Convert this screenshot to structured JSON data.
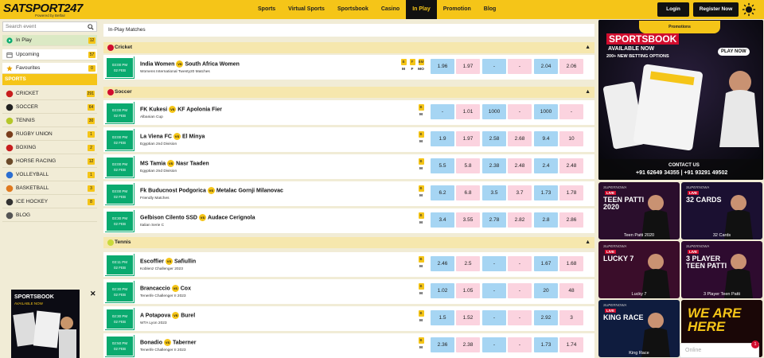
{
  "header": {
    "logo_text": "SATSPORT247",
    "logo_sub": "Powered by Betfair",
    "nav": [
      "Sports",
      "Virtual Sports",
      "Sportsbook",
      "Casino",
      "In Play",
      "Promotion",
      "Blog"
    ],
    "active_nav": "In Play",
    "login_label": "Login",
    "register_label": "Register Now"
  },
  "sidebar": {
    "search_placeholder": "Search event",
    "quick": [
      {
        "label": "In Play",
        "count": "12"
      },
      {
        "label": "Upcoming",
        "count": "57"
      },
      {
        "label": "Favourites",
        "count": "0"
      }
    ],
    "sports_label": "SPORTS",
    "sports": [
      {
        "label": "CRICKET",
        "count": "291",
        "icon": "cricket-ball-icon"
      },
      {
        "label": "SOCCER",
        "count": "64",
        "icon": "soccer-ball-icon"
      },
      {
        "label": "TENNIS",
        "count": "30",
        "icon": "tennis-ball-icon"
      },
      {
        "label": "RUGBY UNION",
        "count": "1",
        "icon": "rugby-ball-icon"
      },
      {
        "label": "BOXING",
        "count": "2",
        "icon": "boxing-glove-icon"
      },
      {
        "label": "HORSE RACING",
        "count": "12",
        "icon": "horse-icon"
      },
      {
        "label": "VOLLEYBALL",
        "count": "1",
        "icon": "volleyball-icon"
      },
      {
        "label": "BASKETBALL",
        "count": "3",
        "icon": "basketball-icon"
      },
      {
        "label": "ICE HOCKEY",
        "count": "8",
        "icon": "hockey-stick-icon"
      },
      {
        "label": "BLOG",
        "count": "",
        "icon": "blog-icon"
      }
    ],
    "ad_title": "SPORTSBOOK",
    "ad_sub": "AVAILABLE NOW"
  },
  "main": {
    "breadcrumb": "In-Play Matches",
    "sections": [
      {
        "name": "Cricket",
        "color": "#d10d2e",
        "matches": [
          {
            "time": "03:00 PM",
            "date": "02 FEB",
            "home": "India Women",
            "away": "South Africa Women",
            "league": "Womens International Twenty20 Matches",
            "markets": [
              {
                "b": "B",
                "t": "M"
              },
              {
                "b": "F",
                "t": "F"
              },
              {
                "b": "BM",
                "t": "MO"
              }
            ],
            "odds": [
              "1.96",
              "1.97",
              "-",
              "-",
              "2.04",
              "2.06"
            ]
          }
        ]
      },
      {
        "name": "Soccer",
        "color": "#d10d2e",
        "matches": [
          {
            "time": "03:00 PM",
            "date": "02 FEB",
            "home": "FK Kukesi",
            "away": "KF Apolonia Fier",
            "league": "Albanian Cup",
            "markets": [
              {
                "b": "B",
                "t": "M"
              }
            ],
            "odds": [
              "-",
              "1.01",
              "1000",
              "-",
              "1000",
              "-"
            ]
          },
          {
            "time": "03:00 PM",
            "date": "02 FEB",
            "home": "La Viena FC",
            "away": "El Minya",
            "league": "Egyptian 2nd Division",
            "markets": [
              {
                "b": "B",
                "t": "M"
              }
            ],
            "odds": [
              "1.9",
              "1.97",
              "2.58",
              "2.68",
              "9.4",
              "10"
            ]
          },
          {
            "time": "03:00 PM",
            "date": "02 FEB",
            "home": "MS Tamia",
            "away": "Nasr Taaden",
            "league": "Egyptian 2nd Division",
            "markets": [
              {
                "b": "B",
                "t": "M"
              }
            ],
            "odds": [
              "5.5",
              "5.8",
              "2.38",
              "2.48",
              "2.4",
              "2.48"
            ]
          },
          {
            "time": "03:00 PM",
            "date": "02 FEB",
            "home": "Fk Buducnost Podgorica",
            "away": "Metalac Gornji Milanovac",
            "league": "Friendly Matches",
            "markets": [
              {
                "b": "B",
                "t": "M"
              }
            ],
            "odds": [
              "6.2",
              "6.8",
              "3.5",
              "3.7",
              "1.73",
              "1.78"
            ]
          },
          {
            "time": "03:30 PM",
            "date": "02 FEB",
            "home": "Gelbison Cilento SSD",
            "away": "Audace Cerignola",
            "league": "Italian Serie C",
            "markets": [
              {
                "b": "B",
                "t": "M"
              }
            ],
            "odds": [
              "3.4",
              "3.55",
              "2.78",
              "2.82",
              "2.8",
              "2.86"
            ]
          }
        ]
      },
      {
        "name": "Tennis",
        "color": "#c9d93b",
        "matches": [
          {
            "time": "03:11 PM",
            "date": "02 FEB",
            "home": "Escoffier",
            "away": "Safiullin",
            "league": "Koblenz Challenger 2023",
            "markets": [
              {
                "b": "B",
                "t": "M"
              }
            ],
            "odds": [
              "2.46",
              "2.5",
              "-",
              "-",
              "1.67",
              "1.68"
            ]
          },
          {
            "time": "02:30 PM",
            "date": "02 FEB",
            "home": "Brancaccio",
            "away": "Cox",
            "league": "Tenerife Challenger II 2023",
            "markets": [
              {
                "b": "B",
                "t": "M"
              }
            ],
            "odds": [
              "1.02",
              "1.05",
              "-",
              "-",
              "20",
              "48"
            ]
          },
          {
            "time": "02:30 PM",
            "date": "02 FEB",
            "home": "A Potapova",
            "away": "Burel",
            "league": "WTA Lyon 2023",
            "markets": [
              {
                "b": "B",
                "t": "M"
              }
            ],
            "odds": [
              "1.5",
              "1.52",
              "-",
              "-",
              "2.92",
              "3"
            ]
          },
          {
            "time": "02:50 PM",
            "date": "02 FEB",
            "home": "Bonadio",
            "away": "Taberner",
            "league": "Tenerife Challenger II 2023",
            "markets": [
              {
                "b": "B",
                "t": "M"
              }
            ],
            "odds": [
              "2.36",
              "2.38",
              "-",
              "-",
              "1.73",
              "1.74"
            ]
          }
        ]
      }
    ]
  },
  "right": {
    "promo_label": "Promotions",
    "banner": {
      "title": "SPORTSBOOK",
      "available": "AVAILABLE NOW",
      "sub": "200+ NEW BETTING OPTIONS",
      "play": "PLAY NOW",
      "contact": "CONTACT US",
      "phones": "+91 62649 34355 | +91 93291 49502"
    },
    "games": [
      {
        "title": "TEEN PATTI 2020",
        "cap": "Teen Patti 2020"
      },
      {
        "title": "32 CARDS",
        "cap": "32 Cards"
      },
      {
        "title": "LUCKY 7",
        "cap": "Lucky 7"
      },
      {
        "title": "3 PLAYER TEEN PATTI",
        "cap": "3 Player Teen Patti"
      },
      {
        "title": "KING RACE",
        "cap": "King Race"
      },
      {
        "title": "WE ARE HERE",
        "cap": ""
      }
    ],
    "game_brand": "SUPERNOWA",
    "live_label": "LIVE",
    "online_label": "Online",
    "online_count": "1"
  },
  "colors": {
    "accent": "#f5c518",
    "back": "#a6d5f3",
    "lay": "#fbd3df",
    "green": "#0aaa6f"
  }
}
